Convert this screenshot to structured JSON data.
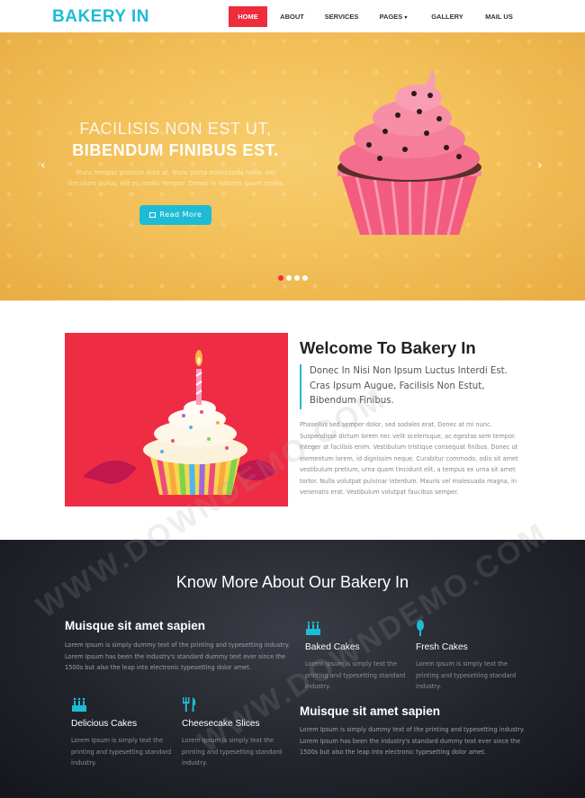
{
  "brand": {
    "logo": "BAKERY IN",
    "accent": "#1ebbd7",
    "red": "#ed2d3c"
  },
  "nav": {
    "items": [
      {
        "label": "HOME",
        "active": true
      },
      {
        "label": "ABOUT"
      },
      {
        "label": "SERVICES"
      },
      {
        "label": "PAGES"
      },
      {
        "label": "GALLERY"
      },
      {
        "label": "MAIL US"
      }
    ],
    "dropdown_icon": "caret-down-icon"
  },
  "hero": {
    "title_line1": "FACILISIS NON EST UT,",
    "title_line2": "BIBENDUM FINIBUS EST.",
    "description": "Nunc tempor pretium eros at. Nunc porta malesuada nulla, nec tincidunt purus, elit eu mollis tempor. Donec in lobortis quam mollis.",
    "button_label": "Read More",
    "button_icon": "book-icon",
    "slides": 4,
    "active_slide": 1,
    "prev_icon": "chevron-left-icon",
    "next_icon": "chevron-right-icon"
  },
  "welcome": {
    "title": "Welcome To Bakery In",
    "quote": "Donec In Nisi Non Ipsum Luctus Interdi Est. Cras Ipsum Augue, Facilisis Non Estut, Bibendum Finibus.",
    "body": "Phasellus sed semper dolor, sed sodales erat. Donec at mi nunc. Suspendisse dictum lorem nec velit scelerisque, ac egestas sem tempor. Integer at facilisis enim. Vestibulum tristique consequat finibus. Donec ut elementum lorem, id dignissim neque. Curabitur commodo, odio sit amet vestibulum pretium, urna quam tincidunt elit, a tempus ex urna sit amet tortor. Nulla volutpat pulvinar interdum. Mauris vel malesuada magna, in venenatis erat. Vestibulum volutpat faucibus semper."
  },
  "about": {
    "title": "Know More About Our Bakery In",
    "block1_title": "Muisque sit amet sapien",
    "block1_text": "Lorem Ipsum is simply dummy text of the printing and typesetting industry. Lorem Ipsum has been the industry's standard dummy text ever since the 1500s but also the leap into electronic typesetting dolor amet.",
    "block2_title": "Muisque sit amet sapien",
    "block2_text": "Lorem Ipsum is simply dummy text of the printing and typesetting industry. Lorem Ipsum has been the industry's standard dummy text ever since the 1500s but also the leap into electronic typesetting dolor amet.",
    "features": [
      {
        "name": "Baked Cakes",
        "icon": "birthday-cake-icon",
        "text": "Lorem Ipsum is simply text the printing and typesetting standard industry."
      },
      {
        "name": "Fresh Cakes",
        "icon": "ice-lolly-icon",
        "text": "Lorem Ipsum is simply text the printing and typesetting standard industry."
      },
      {
        "name": "Delicious Cakes",
        "icon": "birthday-cake-icon",
        "text": "Lorem Ipsum is simply text the printing and typesetting standard industry."
      },
      {
        "name": "Cheesecake Slices",
        "icon": "cutlery-icon",
        "text": "Lorem Ipsum is simply text the printing and typesetting standard industry."
      }
    ]
  },
  "watermark": "WWW.DOWNDEMO.COM"
}
